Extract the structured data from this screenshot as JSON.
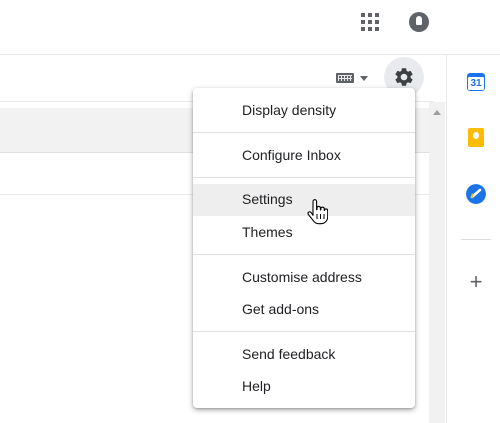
{
  "header": {
    "apps_icon": "apps-grid-icon",
    "account_icon": "account-avatar-icon"
  },
  "toolbar": {
    "input_tools_icon": "keyboard-icon",
    "settings_icon": "gear-icon"
  },
  "side_panel": {
    "apps": [
      {
        "name": "calendar-icon",
        "label": "31",
        "color": "#1a73e8"
      },
      {
        "name": "keep-icon",
        "color": "#fbbc04"
      },
      {
        "name": "tasks-icon",
        "color": "#1a73e8"
      },
      {
        "name": "plus-icon",
        "label": "+"
      }
    ]
  },
  "settings_menu": {
    "items": [
      {
        "label": "Display density"
      },
      {
        "label": "Configure Inbox"
      },
      {
        "label": "Settings",
        "hovered": true
      },
      {
        "label": "Themes"
      },
      {
        "label": "Customise address"
      },
      {
        "label": "Get add-ons"
      },
      {
        "label": "Send feedback"
      },
      {
        "label": "Help"
      }
    ]
  },
  "colors": {
    "icon_gray": "#5f6368",
    "hover_bg": "#eeeeee",
    "accent_blue": "#1a73e8",
    "keep_yellow": "#fbbc04"
  }
}
